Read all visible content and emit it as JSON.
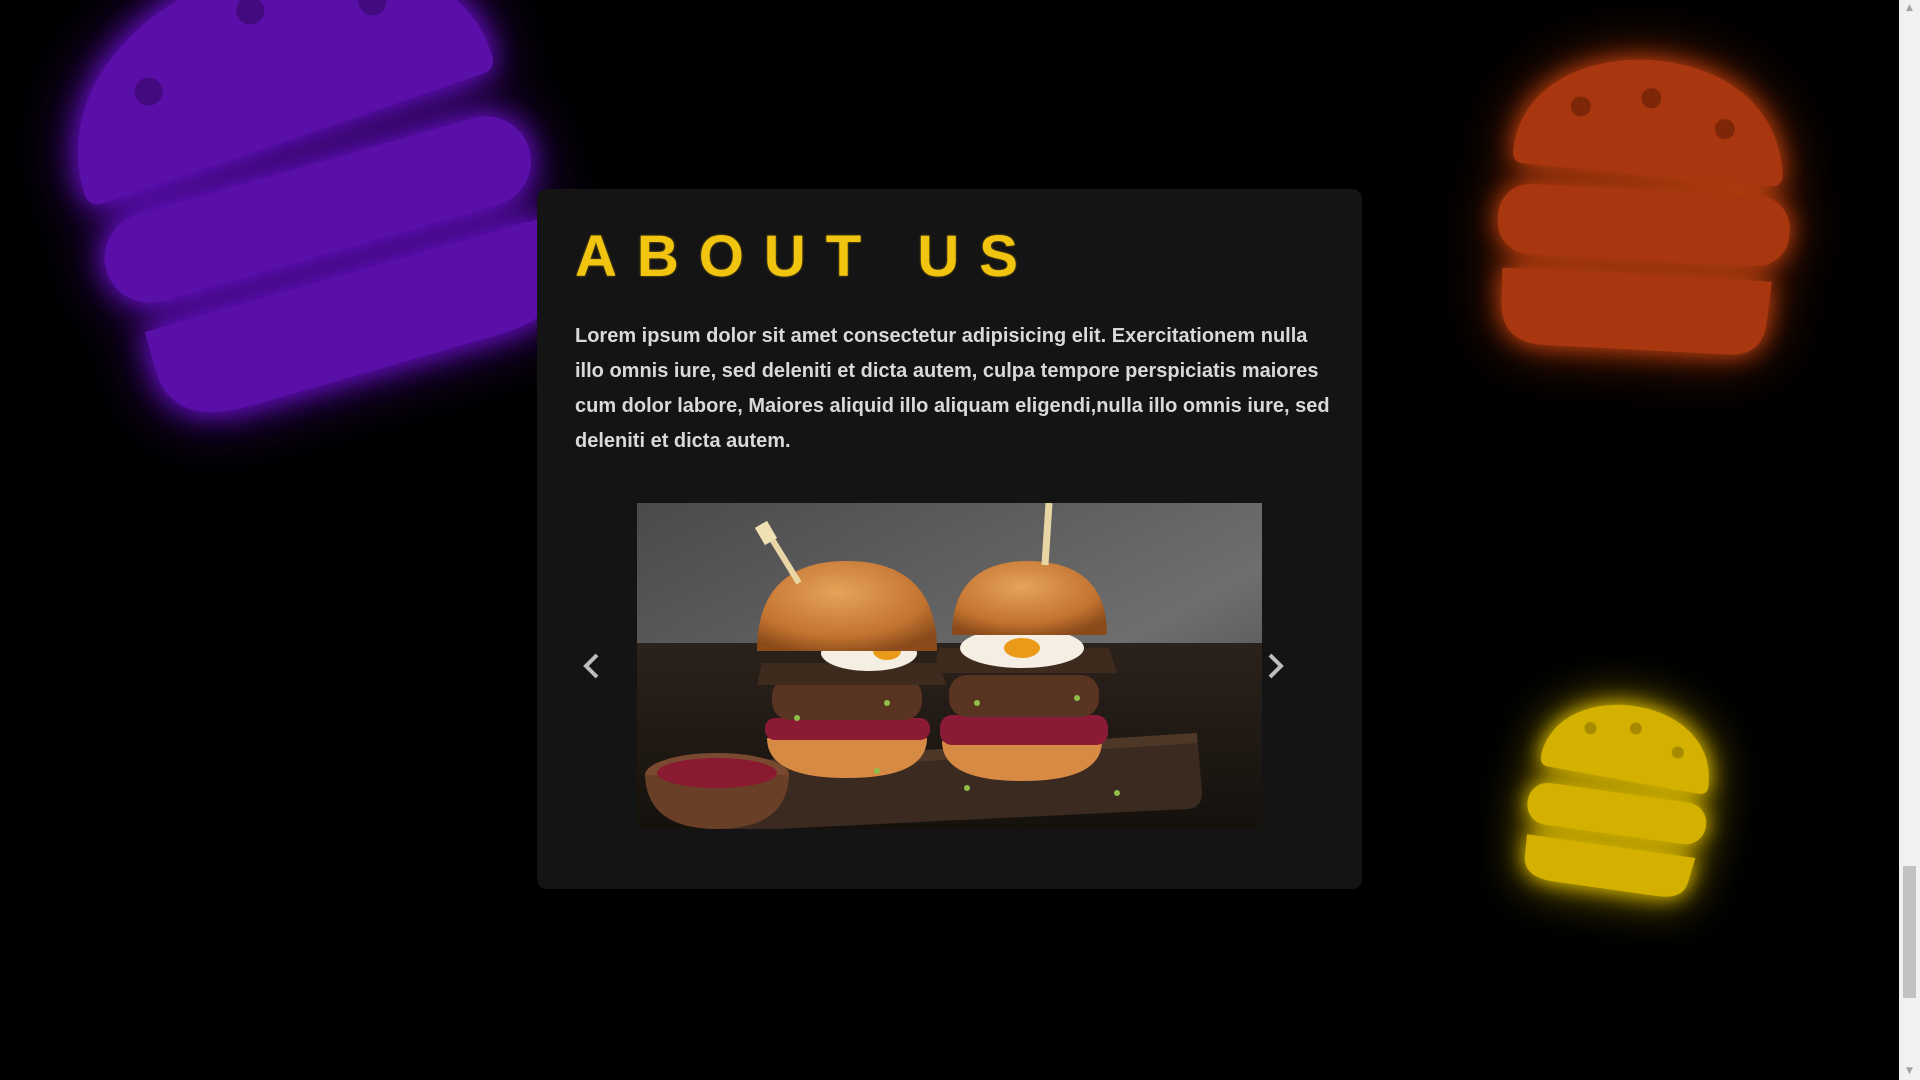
{
  "about": {
    "title": "ABOUT US",
    "text": "Lorem ipsum dolor sit amet consectetur adipisicing elit. Exercitationem nulla illo omnis iure, sed deleniti et dicta autem, culpa tempore perspiciatis maiores cum dolor labore, Maiores aliquid illo aliquam eligendi,nulla illo omnis iure, sed deleniti et dicta autem."
  },
  "carousel": {
    "image_alt": "burgers-photo",
    "prev_icon": "chevron-left-icon",
    "next_icon": "chevron-right-icon"
  },
  "decorations": {
    "burger_colors": [
      "#5a0fa8",
      "#a8360f",
      "#d4b000"
    ]
  },
  "colors": {
    "background": "#000000",
    "card": "#141414",
    "title": "#f1c40f",
    "text": "#d9d9d9"
  }
}
